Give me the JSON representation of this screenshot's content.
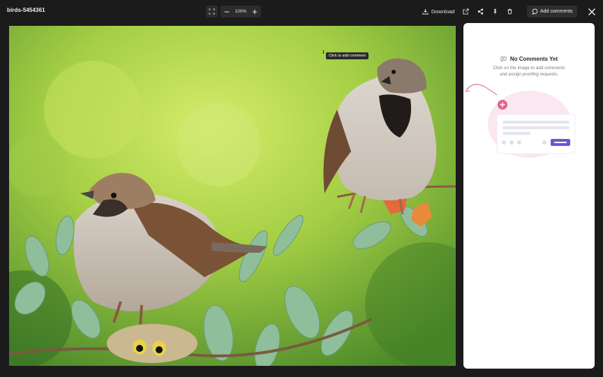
{
  "header": {
    "file_name": "birds-5454361",
    "zoom_level": "100%",
    "download_label": "Download",
    "add_comments_label": "Add comments"
  },
  "image": {
    "tooltip": "Click to add comment"
  },
  "comments_panel": {
    "empty_title": "No Comments Yet",
    "empty_desc_line1": "Click on the image to add comments",
    "empty_desc_line2": "and assign proofing requests."
  },
  "colors": {
    "accent": "#6b55d8",
    "pink": "#e2648a",
    "background": "#1b1b1b"
  },
  "icons": [
    "fit-screen-icon",
    "zoom-out-icon",
    "zoom-in-icon",
    "download-icon",
    "open-external-icon",
    "share-icon",
    "pin-icon",
    "trash-icon",
    "comment-icon",
    "close-icon"
  ]
}
